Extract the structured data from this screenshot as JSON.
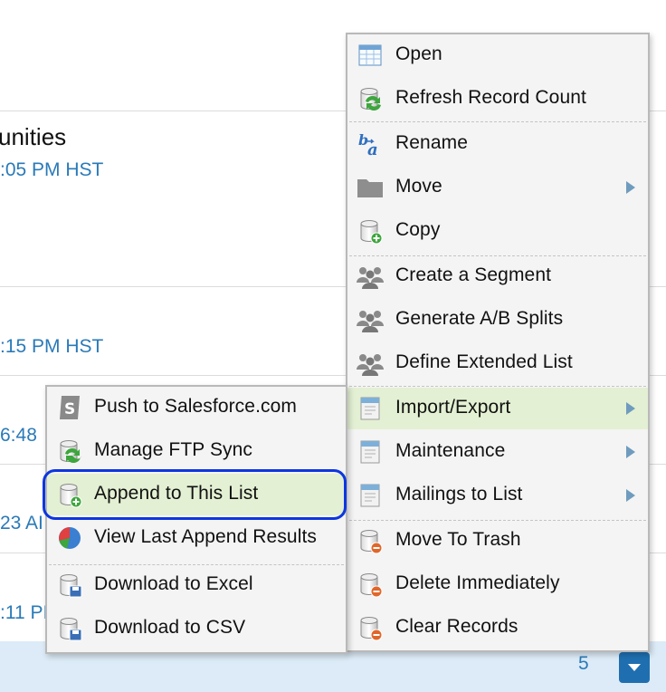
{
  "background": {
    "title_fragment": "unities",
    "times": [
      ":05 PM HST",
      ":15 PM HST",
      "6:48",
      "23 AI",
      ":11 PI"
    ],
    "page_number": "5"
  },
  "main_menu": {
    "items": [
      {
        "label": "Open",
        "icon": "table-icon"
      },
      {
        "label": "Refresh Record Count",
        "icon": "database-refresh-icon"
      },
      {
        "label": "Rename",
        "icon": "rename-icon"
      },
      {
        "label": "Move",
        "icon": "folder-icon",
        "submenu": true
      },
      {
        "label": "Copy",
        "icon": "database-add-icon"
      },
      {
        "label": "Create a Segment",
        "icon": "people-icon"
      },
      {
        "label": "Generate A/B Splits",
        "icon": "people-icon"
      },
      {
        "label": "Define Extended List",
        "icon": "people-icon"
      },
      {
        "label": "Import/Export",
        "icon": "document-icon",
        "submenu": true,
        "highlighted": true
      },
      {
        "label": "Maintenance",
        "icon": "document-icon",
        "submenu": true
      },
      {
        "label": "Mailings to List",
        "icon": "document-icon",
        "submenu": true
      },
      {
        "label": "Move To Trash",
        "icon": "database-delete-icon"
      },
      {
        "label": "Delete Immediately",
        "icon": "database-delete-icon"
      },
      {
        "label": "Clear Records",
        "icon": "database-delete-icon"
      }
    ]
  },
  "sub_menu": {
    "items": [
      {
        "label": "Push to Salesforce.com",
        "icon": "salesforce-icon"
      },
      {
        "label": "Manage FTP Sync",
        "icon": "database-refresh-icon"
      },
      {
        "label": "Append to This List",
        "icon": "database-add-icon",
        "highlighted": true
      },
      {
        "label": "View Last Append Results",
        "icon": "pie-chart-icon"
      },
      {
        "label": "Download to Excel",
        "icon": "database-download-icon"
      },
      {
        "label": "Download to CSV",
        "icon": "database-download-icon"
      }
    ]
  },
  "colors": {
    "highlight": "#e3f0d3",
    "focus_ring": "#0d36e0",
    "link": "#2a7ab8",
    "footer": "#dcebf7"
  }
}
